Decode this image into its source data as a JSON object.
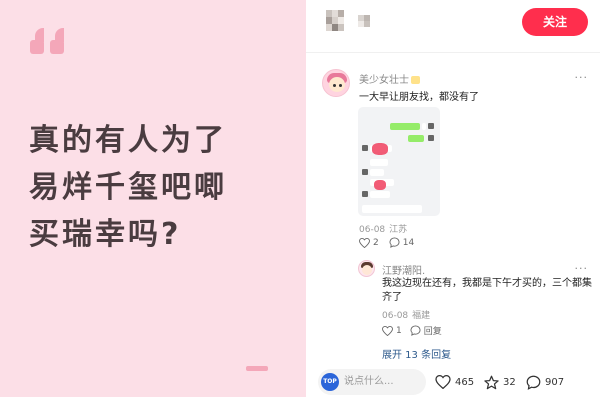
{
  "colors": {
    "left_panel_bg": "#fcdfe7",
    "accent_pink": "#f4a7b9",
    "headline_text": "#4a3c40",
    "follow_button": "#ff2e4d",
    "link_blue": "#2d5a8c"
  },
  "poster": {
    "quote_icon": "quote-icon",
    "headline_lines": [
      "真的有人为了",
      "易烊千玺吧唧",
      "买瑞幸吗?"
    ]
  },
  "header": {
    "follow_label": "关注"
  },
  "comments": [
    {
      "username": "美少女壮士",
      "text": "一大早让朋友找，都没有了",
      "date": "06-08",
      "location": "江苏",
      "likes": "2",
      "replies": "14",
      "has_image": true
    },
    {
      "username": "江野潮阳.",
      "text": "我这边现在还有，我都是下午才买的，三个都集齐了",
      "date": "06-08",
      "location": "福建",
      "likes": "1",
      "reply_label": "回复"
    }
  ],
  "expand_label": "展开 13 条回复",
  "bottom": {
    "top_badge": "TOP",
    "search_placeholder": "说点什么...",
    "likes": "465",
    "stars": "32",
    "comments": "907"
  },
  "more_glyph": "···"
}
